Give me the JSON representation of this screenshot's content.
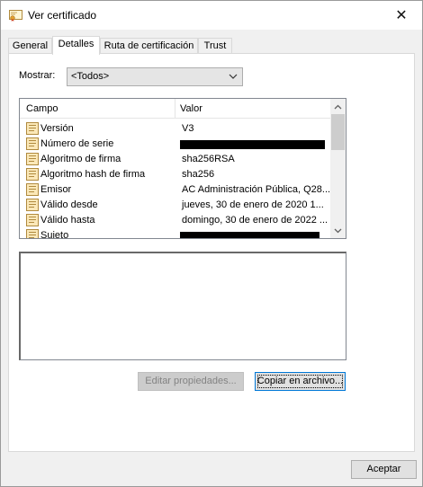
{
  "window": {
    "title": "Ver certificado",
    "close_glyph": "✕"
  },
  "tabs": [
    {
      "label": "General"
    },
    {
      "label": "Detalles",
      "active": true
    },
    {
      "label": "Ruta de certificación"
    },
    {
      "label": "Trust"
    }
  ],
  "details": {
    "show_label": "Mostrar:",
    "show_value": "<Todos>",
    "columns": {
      "field": "Campo",
      "value": "Valor"
    },
    "rows": [
      {
        "field": "Versión",
        "value": "V3"
      },
      {
        "field": "Número de serie",
        "value": "",
        "redacted": true
      },
      {
        "field": "Algoritmo de firma",
        "value": "sha256RSA"
      },
      {
        "field": "Algoritmo hash de firma",
        "value": "sha256"
      },
      {
        "field": "Emisor",
        "value": "AC Administración Pública, Q28..."
      },
      {
        "field": "Válido desde",
        "value": "jueves, 30 de enero de 2020 1..."
      },
      {
        "field": "Válido hasta",
        "value": "domingo, 30 de enero de 2022 ..."
      },
      {
        "field": "Sujeto",
        "value": "",
        "redacted": true
      }
    ],
    "detail_text": "",
    "edit_button": "Editar propiedades...",
    "copy_button": "Copiar en archivo..."
  },
  "footer": {
    "accept_button": "Aceptar"
  },
  "icons": {
    "title": "certificate-icon",
    "field": "certificate-field-icon"
  },
  "colors": {
    "accent_focus": "#0078d7",
    "disabled_text": "#838383"
  }
}
